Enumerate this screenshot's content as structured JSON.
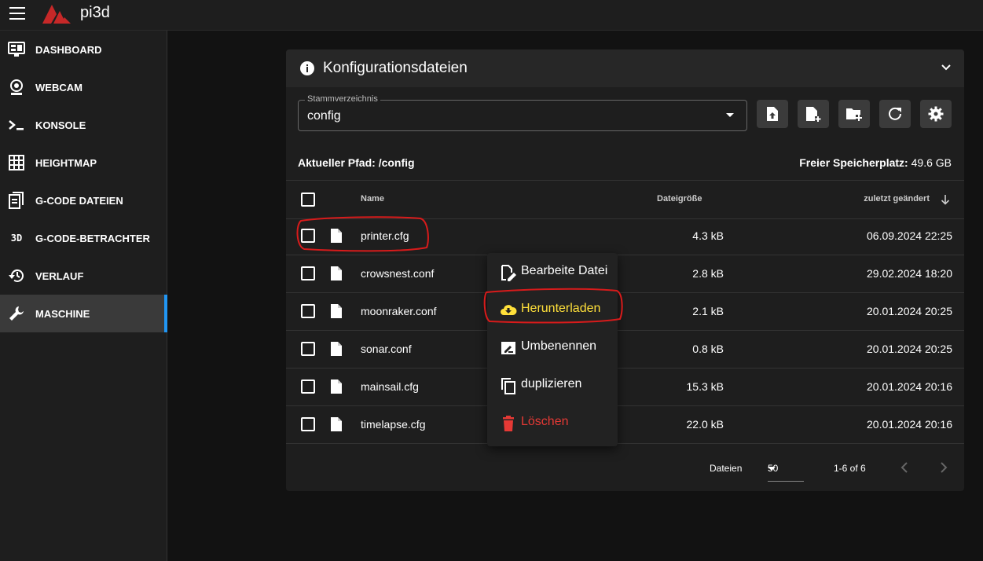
{
  "app": {
    "title": "pi3d"
  },
  "sidebar": {
    "items": [
      {
        "label": "DASHBOARD",
        "icon": "monitor-dashboard-icon"
      },
      {
        "label": "WEBCAM",
        "icon": "webcam-icon"
      },
      {
        "label": "KONSOLE",
        "icon": "console-icon"
      },
      {
        "label": "HEIGHTMAP",
        "icon": "grid-icon"
      },
      {
        "label": "G-CODE DATEIEN",
        "icon": "file-document-icon"
      },
      {
        "label": "G-CODE-BETRACHTER",
        "icon": "3d-text-icon",
        "icon_text": "3D"
      },
      {
        "label": "VERLAUF",
        "icon": "history-icon"
      },
      {
        "label": "MASCHINE",
        "icon": "wrench-icon",
        "active": true
      }
    ]
  },
  "card": {
    "title": "Konfigurationsdateien",
    "root_select": {
      "label": "Stammverzeichnis",
      "value": "config"
    },
    "toolbar": [
      "upload-file-icon",
      "new-file-icon",
      "new-folder-icon",
      "refresh-icon",
      "settings-icon"
    ],
    "current_path": "Aktueller Pfad: /config",
    "storage_label": "Freier Speicherplatz:",
    "storage_value": "49.6 GB",
    "columns": {
      "name": "Name",
      "size": "Dateigröße",
      "modified": "zuletzt geändert"
    },
    "rows": [
      {
        "name": "printer.cfg",
        "size": "4.3 kB",
        "date": "06.09.2024 22:25"
      },
      {
        "name": "crowsnest.conf",
        "size": "2.8 kB",
        "date": "29.02.2024 18:20"
      },
      {
        "name": "moonraker.conf",
        "size": "2.1 kB",
        "date": "20.01.2024 20:25"
      },
      {
        "name": "sonar.conf",
        "size": "0.8 kB",
        "date": "20.01.2024 20:25"
      },
      {
        "name": "mainsail.cfg",
        "size": "15.3 kB",
        "date": "20.01.2024 20:16"
      },
      {
        "name": "timelapse.cfg",
        "size": "22.0 kB",
        "date": "20.01.2024 20:16"
      }
    ],
    "footer": {
      "files_label": "Dateien",
      "per_page": "50",
      "range": "1-6 of 6"
    }
  },
  "context_menu": {
    "items": [
      {
        "label": "Bearbeite Datei",
        "icon": "file-edit-icon"
      },
      {
        "label": "Herunterladen",
        "icon": "cloud-download-icon",
        "color": "#ffe03a"
      },
      {
        "label": "Umbenennen",
        "icon": "rename-icon"
      },
      {
        "label": "duplizieren",
        "icon": "copy-icon"
      },
      {
        "label": "Löschen",
        "icon": "delete-icon",
        "color": "#e53935"
      }
    ]
  },
  "colors": {
    "accent": "#2196f3",
    "annotation": "#d81b1b",
    "highlight": "#ffe03a",
    "danger": "#e53935"
  }
}
